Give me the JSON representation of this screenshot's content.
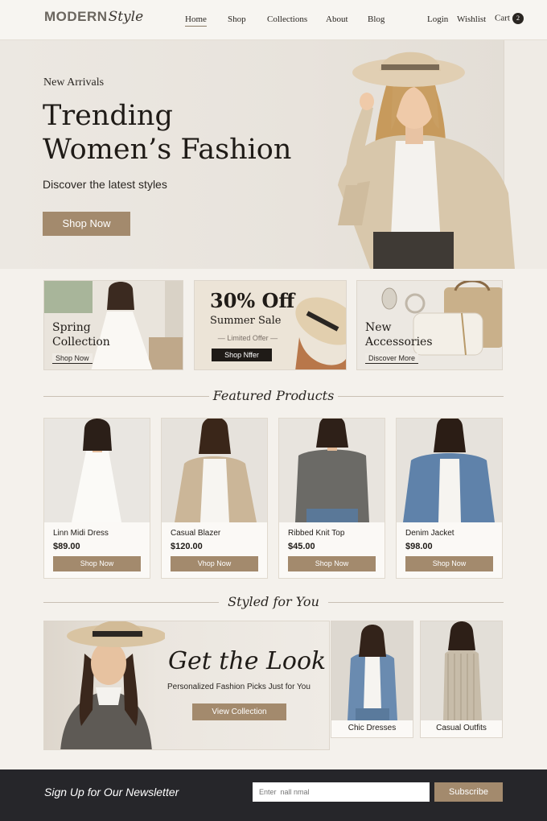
{
  "header": {
    "logo_main": "MODERN",
    "logo_script": "Style",
    "nav": [
      "Home",
      "Shop",
      "Collections",
      "About",
      "Blog"
    ],
    "login": "Login",
    "wishlist": "Wishlist",
    "cart": "Cart",
    "cart_count": "2"
  },
  "hero": {
    "subtitle": "New Arrivals",
    "title_line1": "Trending",
    "title_line2": "Women’s Fashion",
    "description": "Discover the latest styles",
    "button": "Shop Now"
  },
  "promos": [
    {
      "title_line1": "Spring",
      "title_line2": "Collection",
      "link": "Shop Now"
    },
    {
      "headline": "30% Off",
      "title": "Summer Sale",
      "note": "Limited Offer",
      "button": "Shop Nffer"
    },
    {
      "title_line1": "New",
      "title_line2": "Accessories",
      "link": "Discover More"
    }
  ],
  "featured": {
    "title": "Featured Products",
    "products": [
      {
        "name": "Linn Midi Dress",
        "price": "$89.00",
        "button": "Shop Now"
      },
      {
        "name": "Casual Blazer",
        "price": "$120.00",
        "button": "Vhop Now"
      },
      {
        "name": "Ribbed Knit Top",
        "price": "$45.00",
        "button": "Shop Now"
      },
      {
        "name": "Denim Jacket",
        "price": "$98.00",
        "button": "Shop Now"
      }
    ]
  },
  "styled": {
    "title": "Styled for You",
    "look_title": "Get the Look",
    "look_subtitle": "Personalized Fashion Picks Just for You",
    "look_button": "View Collection",
    "minis": [
      "Chic Dresses",
      "Casual Outfits"
    ]
  },
  "newsletter": {
    "title": "Sign Up for Our Newsletter",
    "placeholder": "Enter  nall nmal",
    "button": "Subscribe"
  },
  "colors": {
    "accent": "#a38a6d",
    "background": "#f4f1ec",
    "footer": "#26262a"
  }
}
